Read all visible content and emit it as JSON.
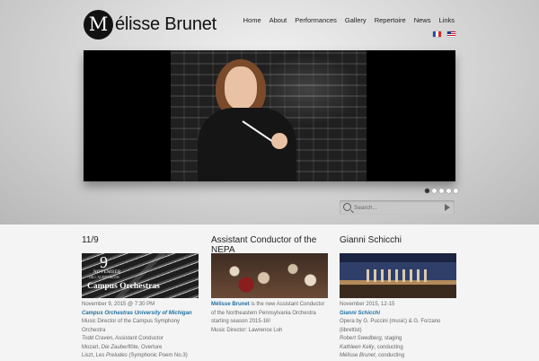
{
  "site": {
    "logo_letter": "M",
    "logo_text": "élisse Brunet"
  },
  "nav": {
    "items": [
      "Home",
      "About",
      "Performances",
      "Gallery",
      "Repertoire",
      "News",
      "Links"
    ]
  },
  "flags": [
    "french-flag-icon",
    "us-flag-icon"
  ],
  "slider": {
    "dots": 5,
    "active_dot": 0
  },
  "search": {
    "placeholder": "Search..."
  },
  "columns": [
    {
      "title": "11/9",
      "thumb": {
        "day": "9",
        "month": "NOVEMBER",
        "venue": "HILL AUDITORIUM",
        "name": "Campus Orchestras"
      },
      "date": "November 9, 2015 @ 7:30 PM",
      "link": "Campus Orchestras University of Michigan",
      "line1": "Music Director of the Campus Symphony Orchestra",
      "line2": "Todd Craven",
      "line2_rest": ", Assistant Conductor",
      "line3a": "Mozart, ",
      "line3b": "Die Zauberflöte",
      "line3c": ", Overture",
      "line4a": "Liszt, ",
      "line4b": "Les Preludes",
      "line4c": " (Symphonic Poem No.3)"
    },
    {
      "title": "Assistant Conductor of the NEPA",
      "name": "Mélisse Brunet",
      "text": " is the new Assistant Conductor of the Northeastern Pennsylvania Orchestra starting season 2015-16!",
      "director": "Music Director: Lawrence Loh"
    },
    {
      "title": "Gianni Schicchi",
      "date": "November 2015, 12-15",
      "link": "Gianni Schicchi",
      "line1": "Opera by G. Puccini (music) & G. Forzano (librettist)",
      "line2": "Robert Swedberg",
      "line2_rest": ", staging",
      "line3": "Kathleen Kelly",
      "line3_rest": ", conducting",
      "line4": "Mélisse Brunet",
      "line4_rest": ", conducting"
    }
  ]
}
